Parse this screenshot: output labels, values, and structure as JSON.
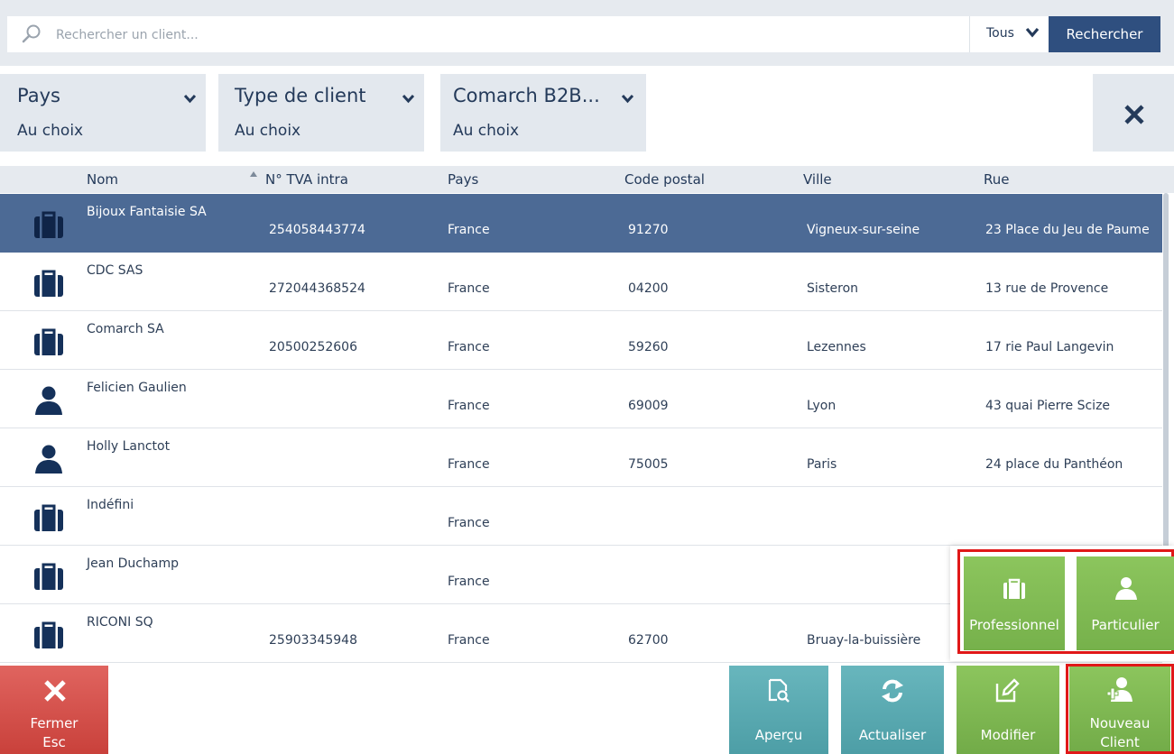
{
  "search": {
    "placeholder": "Rechercher un client...",
    "scope": "Tous",
    "button": "Rechercher"
  },
  "filters": [
    {
      "title": "Pays",
      "value": "Au choix"
    },
    {
      "title": "Type de client",
      "value": "Au choix"
    },
    {
      "title": "Comarch B2B...",
      "value": "Au choix"
    }
  ],
  "columns": [
    "Nom",
    "N° TVA intra",
    "Pays",
    "Code postal",
    "Ville",
    "Rue"
  ],
  "rows": [
    {
      "type": "briefcase-icon",
      "nom": "Bijoux Fantaisie SA",
      "tva": "254058443774",
      "pays": "France",
      "cp": "91270",
      "ville": "Vigneux-sur-seine",
      "rue": "23 Place du Jeu de Paume"
    },
    {
      "type": "briefcase-icon",
      "nom": "CDC SAS",
      "tva": "272044368524",
      "pays": "France",
      "cp": "04200",
      "ville": "Sisteron",
      "rue": "13 rue de Provence"
    },
    {
      "type": "briefcase-icon",
      "nom": "Comarch SA",
      "tva": "20500252606",
      "pays": "France",
      "cp": "59260",
      "ville": "Lezennes",
      "rue": "17 rie Paul Langevin"
    },
    {
      "type": "person-icon",
      "nom": "Felicien Gaulien",
      "tva": "",
      "pays": "France",
      "cp": "69009",
      "ville": "Lyon",
      "rue": "43 quai Pierre Scize"
    },
    {
      "type": "person-icon",
      "nom": "Holly Lanctot",
      "tva": "",
      "pays": "France",
      "cp": "75005",
      "ville": "Paris",
      "rue": "24 place du Panthéon"
    },
    {
      "type": "briefcase-icon",
      "nom": "Indéfini",
      "tva": "",
      "pays": "France",
      "cp": "",
      "ville": "",
      "rue": ""
    },
    {
      "type": "briefcase-icon",
      "nom": "Jean Duchamp",
      "tva": "",
      "pays": "France",
      "cp": "",
      "ville": "",
      "rue": ""
    },
    {
      "type": "briefcase-icon",
      "nom": "RICONI SQ",
      "tva": "25903345948",
      "pays": "France",
      "cp": "62700",
      "ville": "Bruay-la-buissière",
      "rue": ""
    }
  ],
  "popup": {
    "professionnel": "Professionnel",
    "particulier": "Particulier"
  },
  "actions": {
    "fermer": "Fermer",
    "fermer_key": "Esc",
    "apercu": "Aperçu",
    "actualiser": "Actualiser",
    "modifier": "Modifier",
    "nouveau": "Nouveau",
    "nouveau_2": "Client"
  },
  "colors": {
    "selected_row": "#4c6a95",
    "header_bg": "#e6eaef",
    "search_button": "#2f4f7f",
    "green": "#7ab64e",
    "teal": "#5aa9b0",
    "red": "#d4504b",
    "highlight": "#e01818"
  }
}
